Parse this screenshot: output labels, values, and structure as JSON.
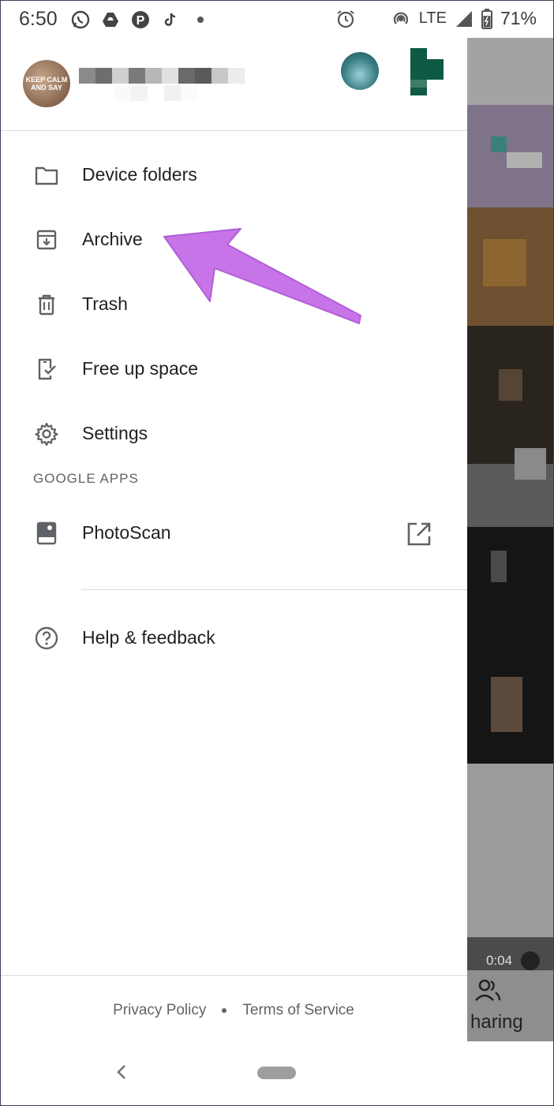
{
  "status_bar": {
    "time": "6:50",
    "network": "LTE",
    "battery": "71%",
    "notification_icons": [
      "whatsapp-icon",
      "drive-icon",
      "pinterest-icon",
      "tiktok-icon",
      "dot-icon"
    ]
  },
  "account": {
    "avatar_text": "KEEP CALM AND SAY"
  },
  "menu": {
    "items": [
      {
        "label": "Device folders",
        "icon": "folder-icon"
      },
      {
        "label": "Archive",
        "icon": "archive-icon"
      },
      {
        "label": "Trash",
        "icon": "trash-icon"
      },
      {
        "label": "Free up space",
        "icon": "free-up-space-icon"
      },
      {
        "label": "Settings",
        "icon": "gear-icon"
      }
    ],
    "section_google_apps": "GOOGLE APPS",
    "photoscan": {
      "label": "PhotoScan",
      "icon": "photoscan-icon",
      "external_icon": "open-in-new-icon"
    },
    "help": {
      "label": "Help & feedback",
      "icon": "help-icon"
    }
  },
  "footer": {
    "privacy": "Privacy Policy",
    "terms": "Terms of Service"
  },
  "background": {
    "video_duration": "0:04",
    "sharing_label": "haring"
  },
  "annotation": {
    "arrow_color": "#c774e8"
  }
}
